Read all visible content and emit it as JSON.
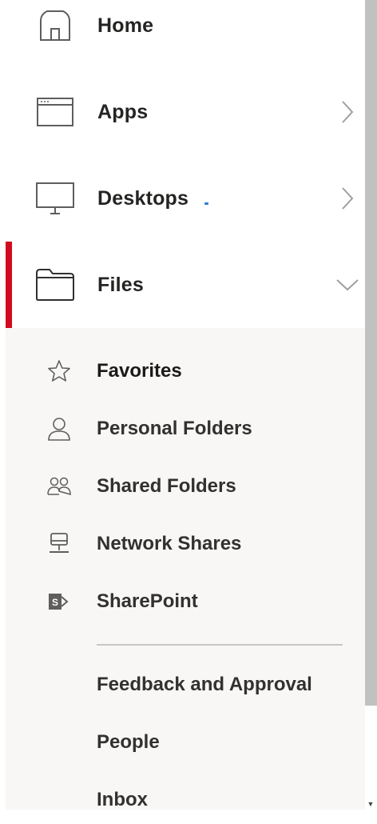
{
  "nav": {
    "items": [
      {
        "label": "Home",
        "icon": "home-icon"
      },
      {
        "label": "Apps",
        "icon": "app-window-icon",
        "chevron": "chevron-right-icon"
      },
      {
        "label": "Desktops",
        "icon": "monitor-icon",
        "chevron": "chevron-right-icon"
      },
      {
        "label": "Files",
        "icon": "folder-icon",
        "chevron": "chevron-down-icon",
        "active": true
      }
    ]
  },
  "files_menu": {
    "items": [
      {
        "label": "Favorites",
        "icon": "star-icon",
        "selected": true
      },
      {
        "label": "Personal Folders",
        "icon": "person-icon"
      },
      {
        "label": "Shared Folders",
        "icon": "people-icon"
      },
      {
        "label": "Network Shares",
        "icon": "network-drive-icon"
      },
      {
        "label": "SharePoint",
        "icon": "sharepoint-icon"
      }
    ],
    "extra_items": [
      {
        "label": "Feedback and Approval"
      },
      {
        "label": "People"
      },
      {
        "label": "Inbox"
      }
    ]
  },
  "colors": {
    "accent": "#d20a1e",
    "panel_bg": "#f8f7f6",
    "text": "#252423",
    "icon_stroke": "#605e5c"
  }
}
